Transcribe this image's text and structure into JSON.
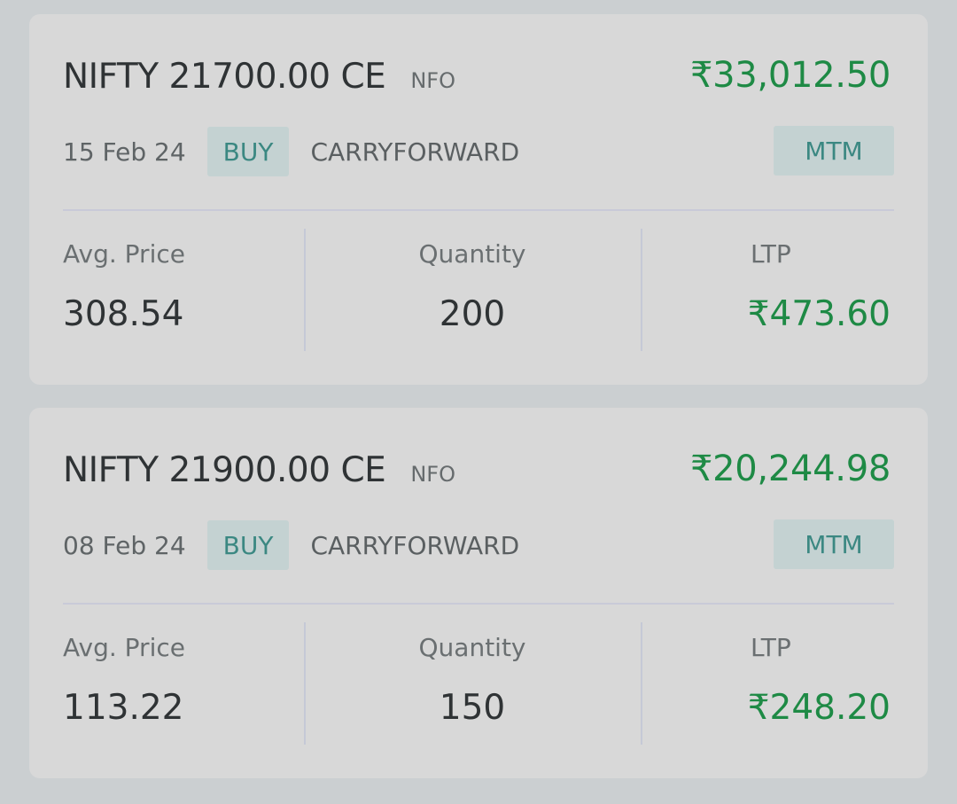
{
  "positions": [
    {
      "symbol": "NIFTY 21700.00 CE",
      "exchange": "NFO",
      "pnl": "₹33,012.50",
      "date": "15 Feb 24",
      "side": "BUY",
      "product": "CARRYFORWARD",
      "mtm_label": "MTM",
      "avg_price_label": "Avg. Price",
      "avg_price": "308.54",
      "quantity_label": "Quantity",
      "quantity": "200",
      "ltp_label": "LTP",
      "ltp": "₹473.60"
    },
    {
      "symbol": "NIFTY 21900.00 CE",
      "exchange": "NFO",
      "pnl": "₹20,244.98",
      "date": "08 Feb 24",
      "side": "BUY",
      "product": "CARRYFORWARD",
      "mtm_label": "MTM",
      "avg_price_label": "Avg. Price",
      "avg_price": "113.22",
      "quantity_label": "Quantity",
      "quantity": "150",
      "ltp_label": "LTP",
      "ltp": "₹248.20"
    }
  ],
  "colors": {
    "background": "#cbcfd1",
    "card": "#d8d8d8",
    "profit_green": "#1e8a45",
    "badge_bg": "#c4d2d2",
    "badge_text": "#3b8882"
  }
}
